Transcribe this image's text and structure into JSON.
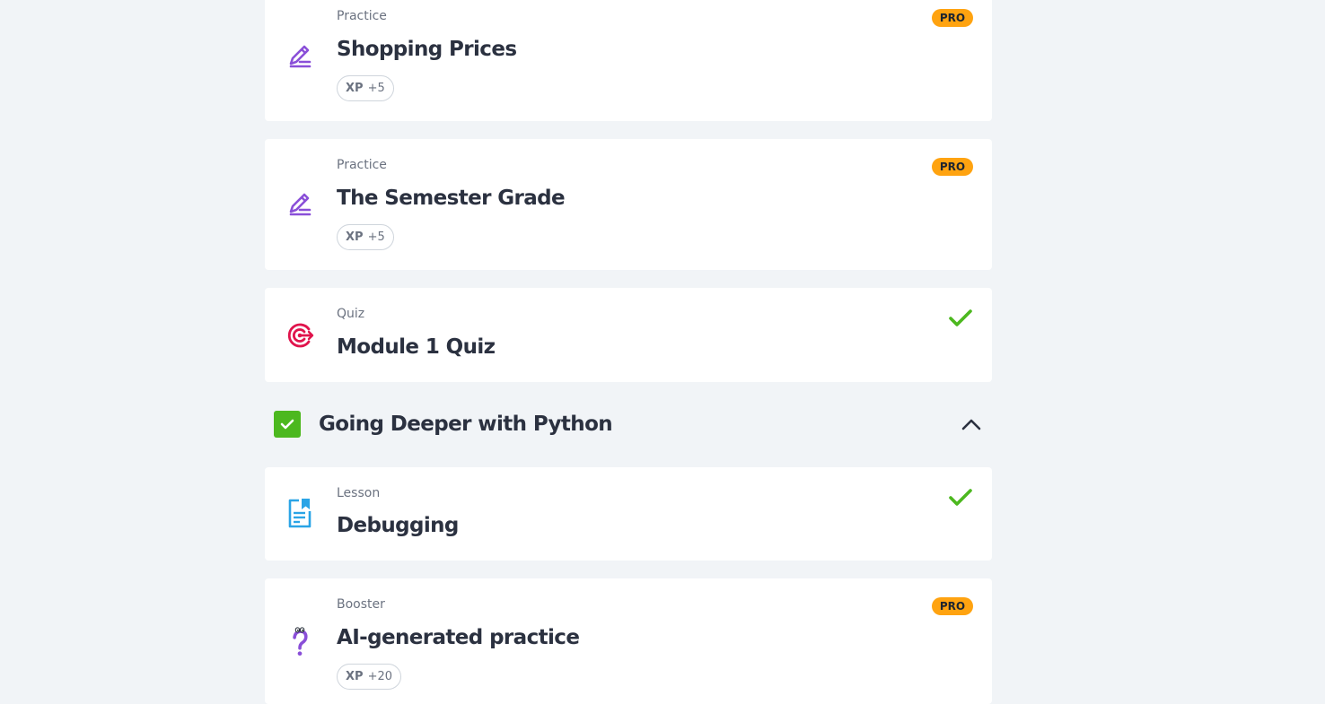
{
  "items": [
    {
      "kind": "Practice",
      "title": "Shopping Prices",
      "xp_label": "XP",
      "xp_value": "+5",
      "badge": "PRO",
      "icon": "pencil-practice-icon"
    },
    {
      "kind": "Practice",
      "title": "The Semester Grade",
      "xp_label": "XP",
      "xp_value": "+5",
      "badge": "PRO",
      "icon": "pencil-practice-icon"
    },
    {
      "kind": "Quiz",
      "title": "Module 1 Quiz",
      "status": "completed",
      "icon": "target-quiz-icon"
    }
  ],
  "section": {
    "title": "Going Deeper with Python",
    "completed": true,
    "expanded": true
  },
  "section_items": [
    {
      "kind": "Lesson",
      "title": "Debugging",
      "status": "completed",
      "icon": "lesson-document-icon"
    },
    {
      "kind": "Booster",
      "title": "AI-generated practice",
      "xp_label": "XP",
      "xp_value": "+20",
      "badge": "PRO",
      "icon": "question-booster-icon"
    }
  ],
  "colors": {
    "background": "#f1f4f7",
    "card": "#ffffff",
    "pro_badge": "#ffa310",
    "check_green": "#4cb81f",
    "practice_purple": "#8a4fd8",
    "quiz_red": "#e0144c",
    "lesson_blue": "#2aa4e6",
    "title_text": "#2b3140",
    "muted_text": "#6b7280"
  }
}
